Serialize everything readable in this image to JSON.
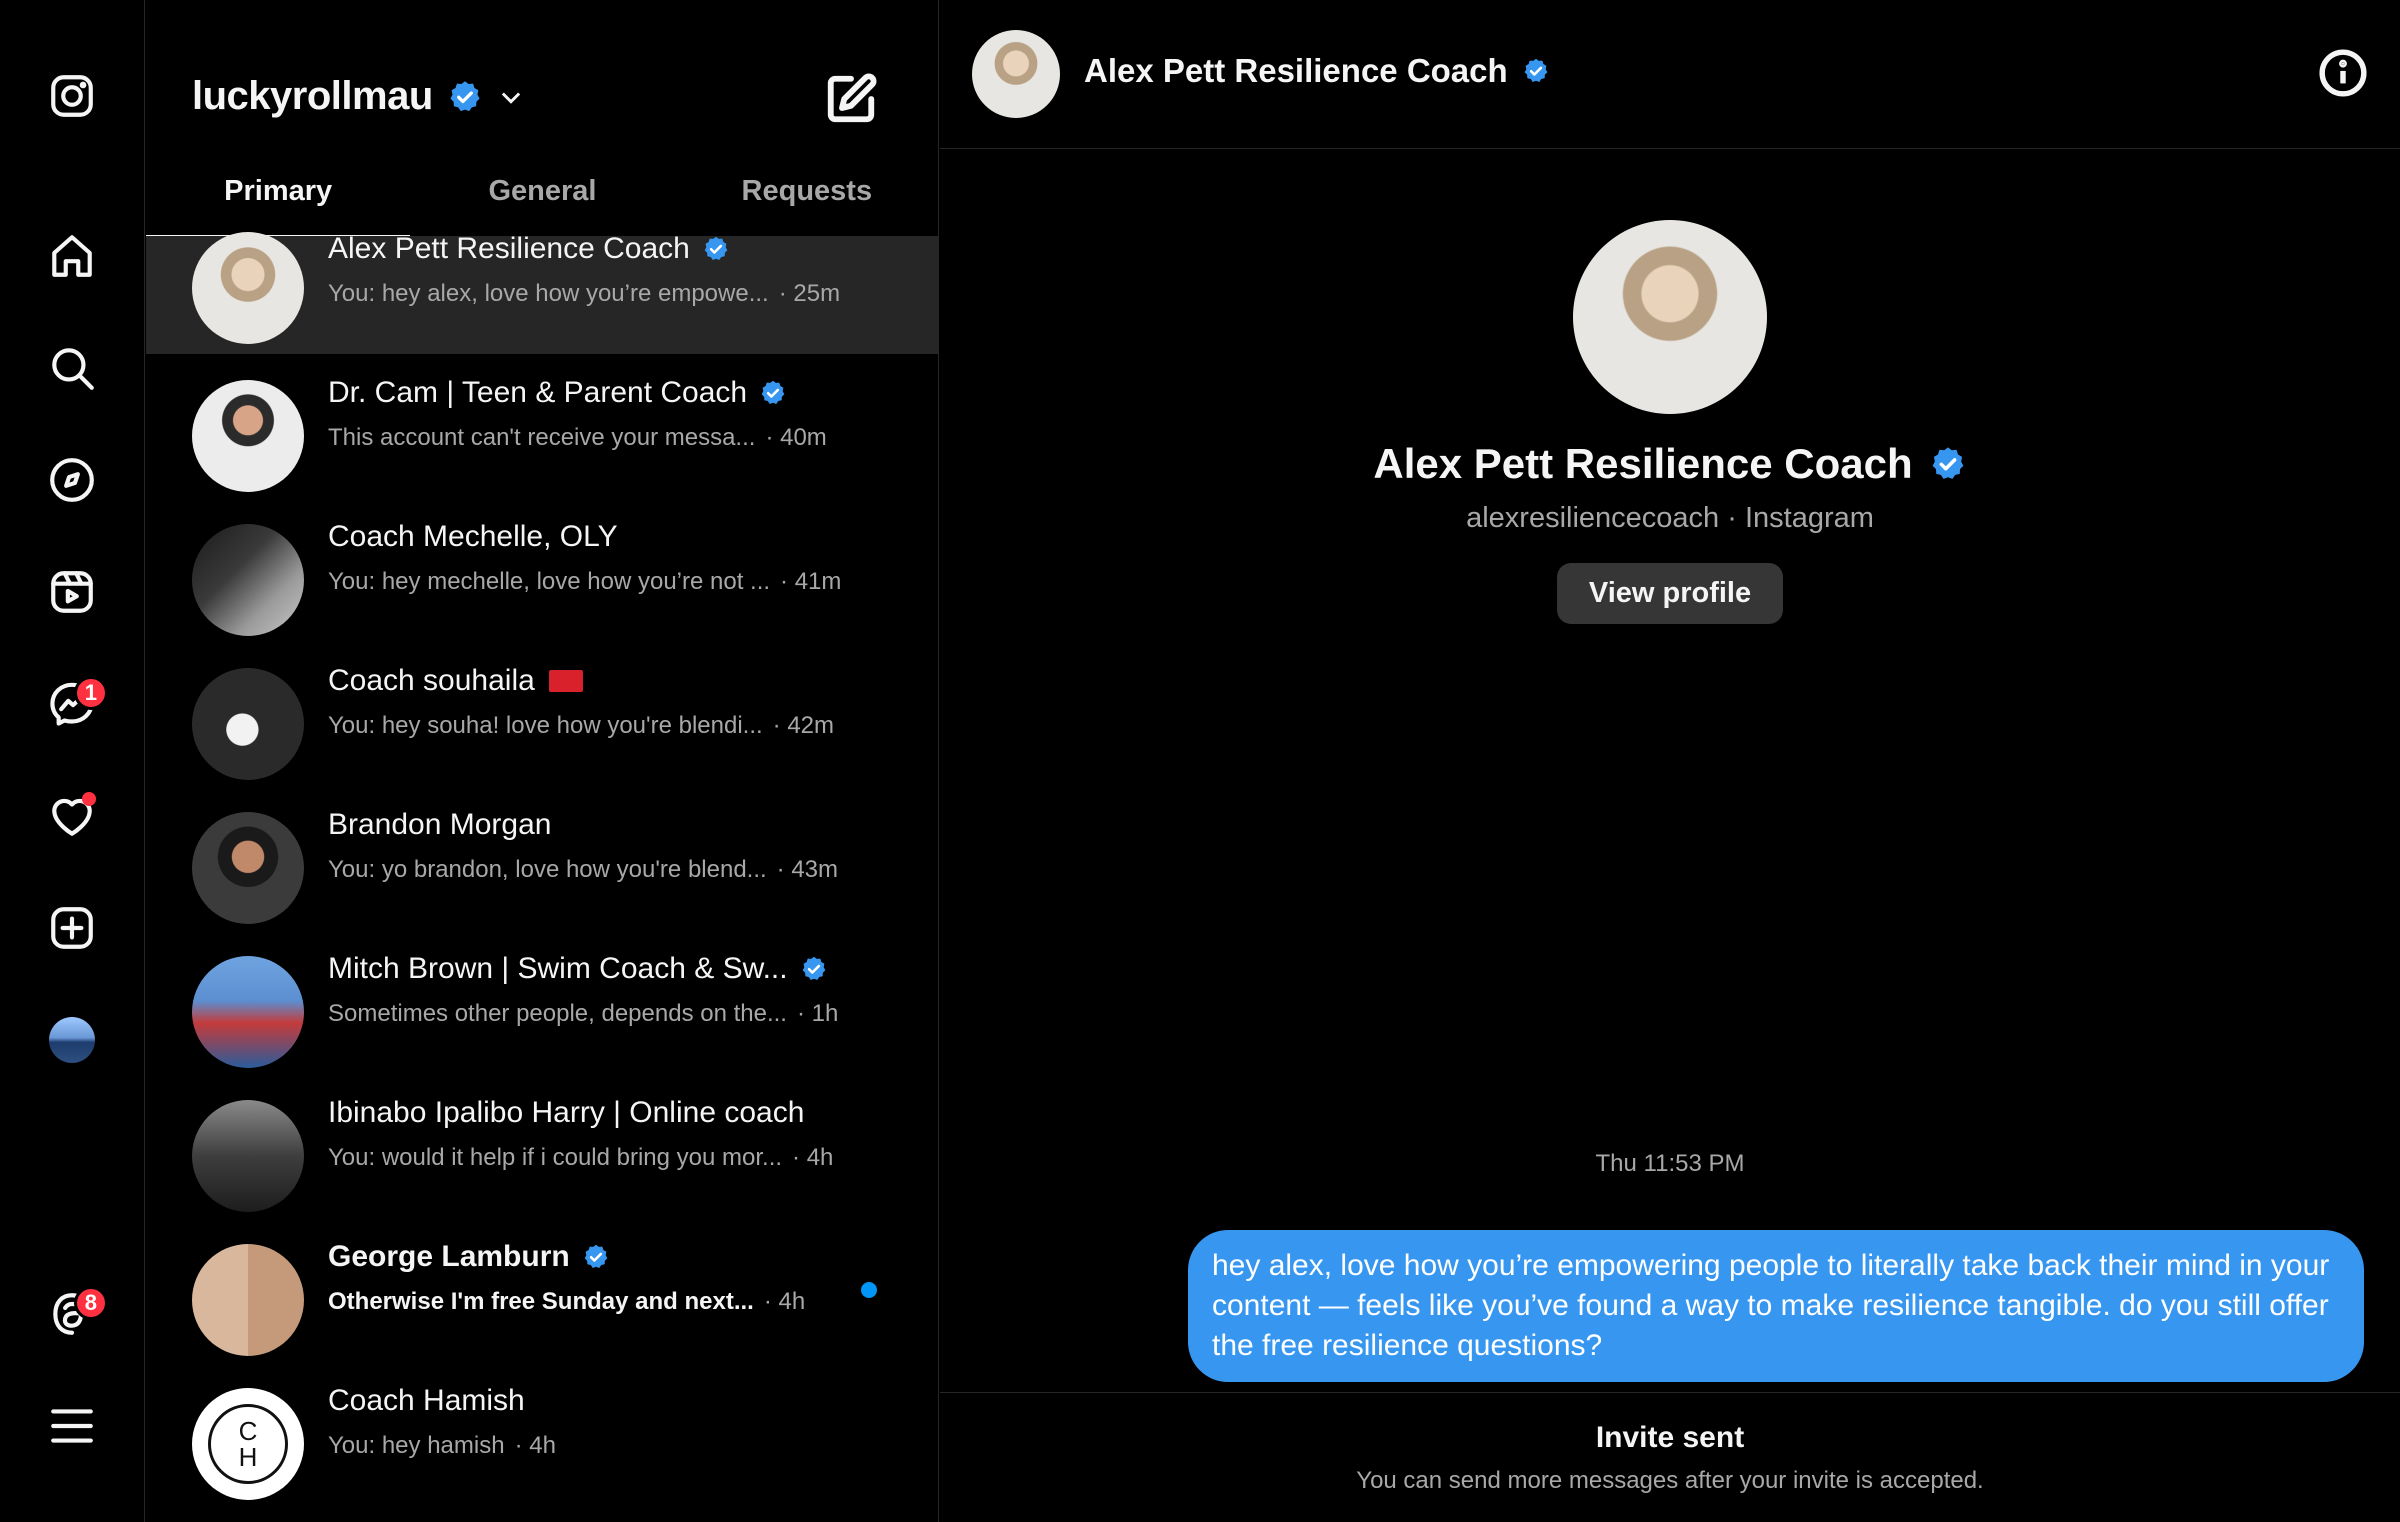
{
  "account": {
    "username": "luckyrollmau"
  },
  "tabs": [
    {
      "label": "Primary",
      "active": true
    },
    {
      "label": "General",
      "active": false
    },
    {
      "label": "Requests",
      "active": false
    }
  ],
  "rail": {
    "messages_badge": "1",
    "threads_badge": "8"
  },
  "threads": [
    {
      "name": "Alex Pett Resilience Coach",
      "verified": true,
      "preview": "You: hey alex, love how you’re empowe...",
      "time": "· 25m",
      "unread": false
    },
    {
      "name": "Dr. Cam | Teen & Parent Coach",
      "verified": true,
      "preview": "This account can't receive your messa...",
      "time": "· 40m",
      "unread": false
    },
    {
      "name": "Coach Mechelle, OLY",
      "verified": false,
      "preview": "You: hey mechelle, love how you’re not ...",
      "time": "· 41m",
      "unread": false
    },
    {
      "name": "Coach souhaila",
      "verified": false,
      "preview": "You: hey souha! love how you're blendi...",
      "time": "· 42m",
      "unread": false
    },
    {
      "name": "Brandon Morgan",
      "verified": false,
      "preview": "You: yo brandon, love how you're blend...",
      "time": "· 43m",
      "unread": false
    },
    {
      "name": "Mitch Brown | Swim Coach & Sw...",
      "verified": true,
      "preview": "Sometimes other people, depends on the...",
      "time": "· 1h",
      "unread": false
    },
    {
      "name": "Ibinabo Ipalibo Harry | Online coach",
      "verified": false,
      "preview": "You: would it help if i could bring you mor...",
      "time": "· 4h",
      "unread": false
    },
    {
      "name": "George Lamburn",
      "verified": true,
      "preview": "Otherwise I'm free Sunday and next...",
      "time": "· 4h",
      "unread": true
    },
    {
      "name": "Coach Hamish",
      "verified": false,
      "preview": "You: hey hamish",
      "time": "· 4h",
      "unread": false
    }
  ],
  "hamish_logo": {
    "line1": "C",
    "line2": "H"
  },
  "chat": {
    "title": "Alex Pett Resilience Coach",
    "profile_name": "Alex Pett Resilience Coach",
    "profile_handle": "alexresiliencecoach · Instagram",
    "view_profile_label": "View profile",
    "timestamp": "Thu 11:53 PM",
    "message": "hey alex, love how you’re empowering people to literally take back their mind in your content — feels like you’ve found a way to make resilience tangible. do you still offer the free resilience questions?",
    "invite_title": "Invite sent",
    "invite_subtitle": "You can send more messages after your invite is accepted."
  },
  "colors": {
    "verified": "#3797f0",
    "bubble": "#3797f0",
    "badge": "#ff3040",
    "unread_dot": "#0095f6"
  }
}
